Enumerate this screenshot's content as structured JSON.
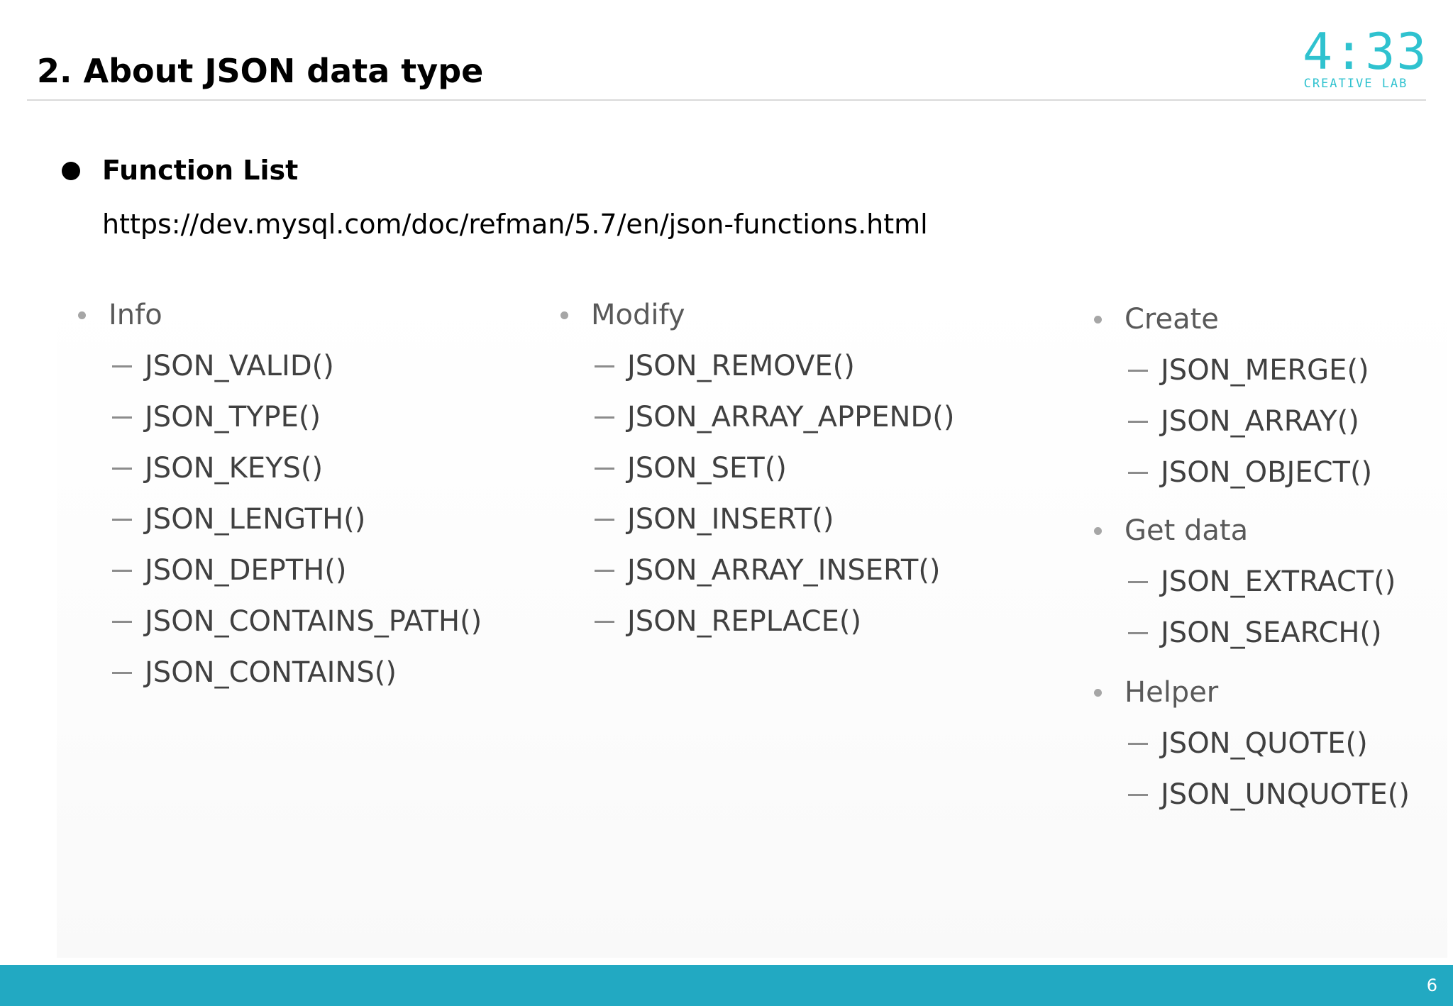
{
  "slide": {
    "title": "2. About JSON data type",
    "page_number": "6"
  },
  "logo": {
    "time": "4:33",
    "subtitle": "CREATIVE LAB"
  },
  "section": {
    "heading": "Function List",
    "link": "https://dev.mysql.com/doc/refman/5.7/en/json-functions.html"
  },
  "columns": [
    {
      "groups": [
        {
          "name": "Info",
          "items": [
            "JSON_VALID()",
            "JSON_TYPE()",
            "JSON_KEYS()",
            "JSON_LENGTH()",
            "JSON_DEPTH()",
            "JSON_CONTAINS_PATH()",
            "JSON_CONTAINS()"
          ]
        }
      ]
    },
    {
      "groups": [
        {
          "name": "Modify",
          "items": [
            "JSON_REMOVE()",
            "JSON_ARRAY_APPEND()",
            "JSON_SET()",
            "JSON_INSERT()",
            "JSON_ARRAY_INSERT()",
            "JSON_REPLACE()"
          ]
        }
      ]
    },
    {
      "groups": [
        {
          "name": "Create",
          "items": [
            "JSON_MERGE()",
            "JSON_ARRAY()",
            "JSON_OBJECT()"
          ]
        },
        {
          "name": "Get data",
          "items": [
            "JSON_EXTRACT()",
            "JSON_SEARCH()"
          ]
        },
        {
          "name": "Helper",
          "items": [
            "JSON_QUOTE()",
            "JSON_UNQUOTE()"
          ]
        }
      ]
    }
  ],
  "colors": {
    "accent": "#22a9c2",
    "logo": "#2fc2cf",
    "group_text": "#595959",
    "item_text": "#404040"
  }
}
